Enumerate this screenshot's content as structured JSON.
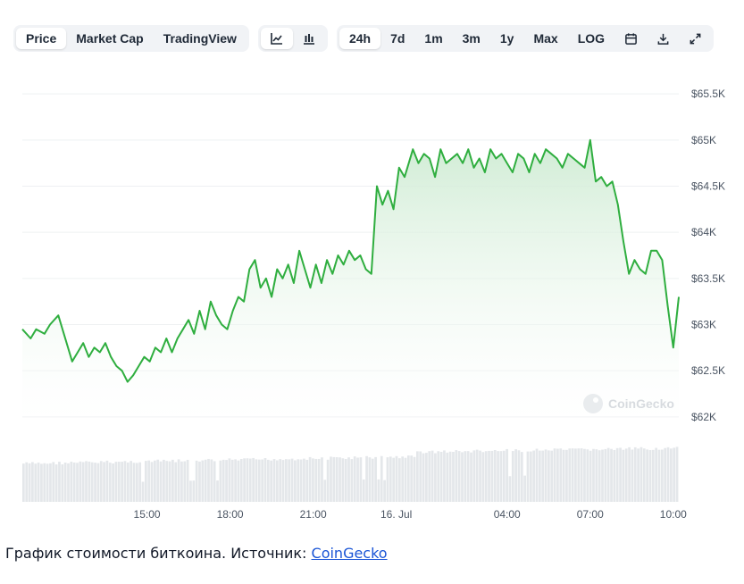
{
  "toolbar": {
    "view_tabs": [
      "Price",
      "Market Cap",
      "TradingView"
    ],
    "active_view": "Price",
    "chart_type_icons": [
      "line-chart-icon",
      "candlestick-icon"
    ],
    "ranges": [
      "24h",
      "7d",
      "1m",
      "3m",
      "1y",
      "Max",
      "LOG"
    ],
    "active_range": "24h",
    "tool_icons": [
      "calendar-icon",
      "download-icon",
      "expand-icon"
    ]
  },
  "watermark": "CoinGecko",
  "caption": {
    "text": "График стоимости биткоина. Источник: ",
    "link": "CoinGecko"
  },
  "colors": {
    "line": "#2fae3f",
    "area_top": "#cdebd2",
    "volume": "#e4e7ea",
    "grid": "#eef0f2",
    "link": "#1a55d6"
  },
  "chart_data": {
    "type": "line",
    "title": "",
    "xlabel": "",
    "ylabel": "",
    "x_ticks": [
      "15:00",
      "18:00",
      "21:00",
      "16. Jul",
      "04:00",
      "07:00",
      "10:00"
    ],
    "x_tick_hours": [
      15,
      18,
      21,
      24,
      28,
      31,
      34
    ],
    "y_ticks": [
      "$62K",
      "$62.5K",
      "$63K",
      "$63.5K",
      "$64K",
      "$64.5K",
      "$65K",
      "$65.5K"
    ],
    "y_tick_values": [
      62000,
      62500,
      63000,
      63500,
      64000,
      64500,
      65000,
      65500
    ],
    "ylim": [
      61950,
      65550
    ],
    "xlim": [
      10.5,
      34.2
    ],
    "grid": true,
    "series": [
      {
        "hours": [
          10.5,
          10.8,
          11.0,
          11.3,
          11.5,
          11.8,
          12.0,
          12.3,
          12.5,
          12.7,
          12.9,
          13.1,
          13.3,
          13.5,
          13.7,
          13.9,
          14.1,
          14.3,
          14.5,
          14.7,
          14.9,
          15.1,
          15.3,
          15.5,
          15.7,
          15.9,
          16.1,
          16.3,
          16.5,
          16.7,
          16.9,
          17.1,
          17.3,
          17.5,
          17.7,
          17.9,
          18.1,
          18.3,
          18.5,
          18.7,
          18.9,
          19.1,
          19.3,
          19.5,
          19.7,
          19.9,
          20.1,
          20.3,
          20.5,
          20.7,
          20.9,
          21.1,
          21.3,
          21.5,
          21.7,
          21.9,
          22.1,
          22.3,
          22.5,
          22.7,
          22.9,
          23.1,
          23.3,
          23.5,
          23.7,
          23.9,
          24.1,
          24.3,
          24.6,
          24.8,
          25.0,
          25.2,
          25.4,
          25.6,
          25.8,
          26.0,
          26.2,
          26.4,
          26.6,
          26.8,
          27.0,
          27.2,
          27.4,
          27.6,
          27.8,
          28.0,
          28.2,
          28.4,
          28.6,
          28.8,
          29.0,
          29.2,
          29.4,
          29.6,
          29.8,
          30.0,
          30.2,
          30.4,
          30.6,
          30.8,
          31.0,
          31.2,
          31.4,
          31.6,
          31.8,
          32.0,
          32.2,
          32.4,
          32.6,
          32.8,
          33.0,
          33.2,
          33.4,
          33.6,
          33.8,
          34.0,
          34.2
        ],
        "values": [
          62950,
          62850,
          62950,
          62900,
          63000,
          63100,
          62900,
          62600,
          62700,
          62800,
          62650,
          62750,
          62700,
          62800,
          62650,
          62550,
          62500,
          62380,
          62450,
          62550,
          62650,
          62600,
          62750,
          62700,
          62850,
          62700,
          62850,
          62950,
          63050,
          62900,
          63150,
          62950,
          63250,
          63100,
          63000,
          62950,
          63150,
          63300,
          63250,
          63600,
          63700,
          63400,
          63500,
          63300,
          63600,
          63500,
          63650,
          63450,
          63800,
          63600,
          63400,
          63650,
          63450,
          63700,
          63550,
          63750,
          63650,
          63800,
          63700,
          63750,
          63600,
          63550,
          64500,
          64300,
          64450,
          64250,
          64700,
          64600,
          64900,
          64750,
          64850,
          64800,
          64600,
          64900,
          64750,
          64800,
          64850,
          64750,
          64900,
          64700,
          64800,
          64650,
          64900,
          64800,
          64850,
          64750,
          64650,
          64850,
          64800,
          64650,
          64850,
          64750,
          64900,
          64850,
          64800,
          64700,
          64850,
          64800,
          64750,
          64700,
          65000,
          64550,
          64600,
          64500,
          64550,
          64300,
          63900,
          63550,
          63700,
          63600,
          63550,
          63800,
          63800,
          63700,
          63200,
          62750,
          63300
        ]
      }
    ],
    "volume_note": "relative volume bars under price (no axis shown)"
  }
}
